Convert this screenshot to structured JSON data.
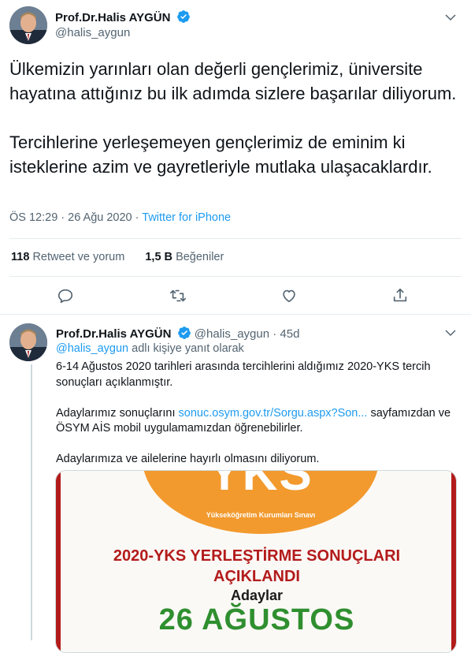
{
  "tweet": {
    "author_name": "Prof.Dr.Halis AYGÜN",
    "author_handle": "@halis_aygun",
    "text": "Ülkemizin yarınları olan değerli gençlerimiz, üniversite hayatına attığınız bu ilk adımda sizlere başarılar diliyorum.\n\nTercihlerine yerleşemeyen gençlerimiz de eminim ki isteklerine azim ve gayretleriyle mutlaka ulaşacaklardır.",
    "time": "ÖS 12:29",
    "date": "26 Ağu 2020",
    "separator": "·",
    "source": "Twitter for iPhone",
    "retweets_count": "118",
    "retweets_label": "Retweet ve yorum",
    "likes_count": "1,5 B",
    "likes_label": "Beğeniler"
  },
  "reply": {
    "author_name": "Prof.Dr.Halis AYGÜN",
    "author_handle": "@halis_aygun",
    "age": "45d",
    "separator": "·",
    "reply_to_mention": "@halis_aygun",
    "reply_to_suffix": " adlı kişiye yanıt olarak",
    "para1": "6-14 Ağustos 2020 tarihleri arasında tercihlerini aldığımız 2020-YKS tercih sonuçları açıklanmıştır.",
    "para2_before": "Adaylarımız sonuçlarını ",
    "para2_link": "sonuc.osym.gov.tr/Sorgu.aspx?Son...",
    "para2_after": " sayfamızdan ve ÖSYM AİS mobil uygulamamızdan öğrenebilirler.",
    "para3": "Adaylarımıza ve ailelerine hayırlı olmasını diliyorum.",
    "image": {
      "logo": "YKS",
      "logo_sub": "Yükseköğretim Kurumları Sınavı",
      "title_line1": "2020-YKS YERLEŞTİRME SONUÇLARI",
      "title_line2": "AÇIKLANDI",
      "subtitle": "Adaylar",
      "date": "26 AĞUSTOS"
    }
  },
  "icons": {
    "verified": "verified-badge-icon",
    "more": "chevron-down-icon",
    "reply": "reply-icon",
    "retweet": "retweet-icon",
    "like": "heart-icon",
    "share": "share-icon"
  },
  "colors": {
    "accent": "#1d9bf0",
    "text": "#0f1419",
    "muted": "#536471",
    "yks_red": "#b31b1b",
    "yks_orange": "#f29a2e",
    "yks_green": "#2f8f2f"
  }
}
